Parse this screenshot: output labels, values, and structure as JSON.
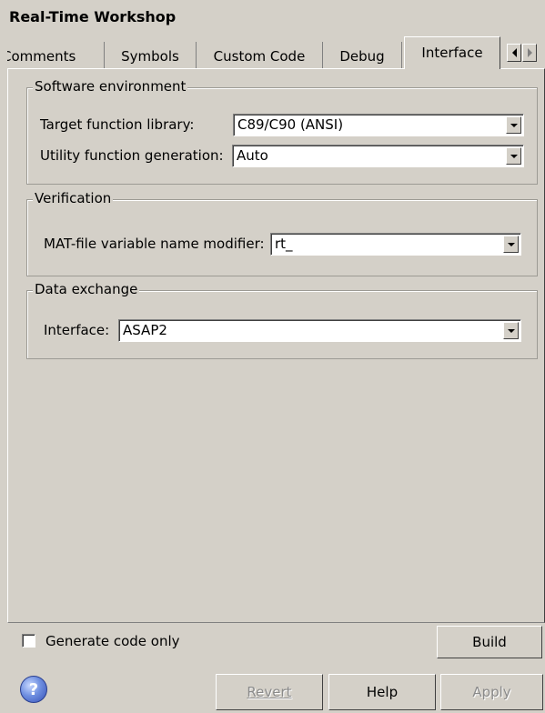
{
  "window": {
    "title": "Real-Time Workshop"
  },
  "tabs": [
    {
      "label": "Comments"
    },
    {
      "label": "Symbols"
    },
    {
      "label": "Custom Code"
    },
    {
      "label": "Debug"
    },
    {
      "label": "Interface",
      "active": true
    }
  ],
  "software_environment": {
    "label": "Software environment",
    "target_function_library": {
      "label": "Target function library:",
      "value": "C89/C90 (ANSI)"
    },
    "utility_function_generation": {
      "label": "Utility function generation:",
      "value": "Auto"
    }
  },
  "verification": {
    "label": "Verification",
    "mat_file_modifier": {
      "label": "MAT-file variable name modifier:",
      "value": "rt_"
    }
  },
  "data_exchange": {
    "label": "Data exchange",
    "interface": {
      "label": "Interface:",
      "value": "ASAP2"
    }
  },
  "footer": {
    "generate_code_only": {
      "label": "Generate code only",
      "checked": false
    },
    "build_label": "Build",
    "revert_label": "Revert",
    "help_label": "Help",
    "apply_label": "Apply",
    "help_icon": "question-mark"
  }
}
